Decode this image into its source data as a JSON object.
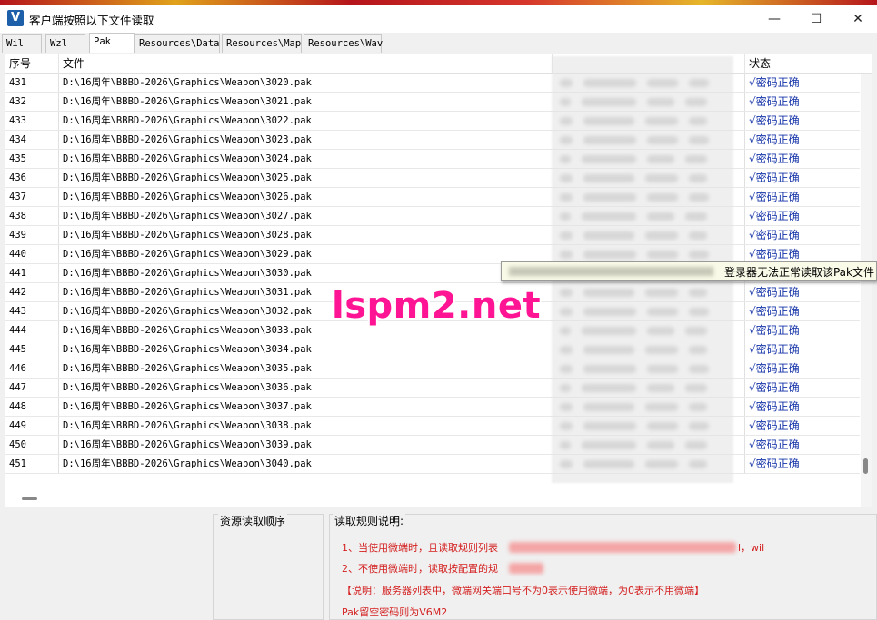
{
  "window": {
    "title": "客户端按照以下文件读取",
    "logo_letter": "V",
    "minimize": "—",
    "maximize": "☐",
    "close": "✕"
  },
  "tabs": [
    {
      "label": "Wil",
      "active": false
    },
    {
      "label": "Wzl",
      "active": false
    },
    {
      "label": "Pak",
      "active": true
    },
    {
      "label": "Resources\\Data",
      "active": false
    },
    {
      "label": "Resources\\Map",
      "active": false
    },
    {
      "label": "Resources\\Wav",
      "active": false
    }
  ],
  "table": {
    "headers": {
      "index": "序号",
      "file": "文件",
      "status": "状态"
    },
    "rows": [
      {
        "index": "431",
        "file": "D:\\16周年\\BBBD-2026\\Graphics\\Weapon\\3020.pak",
        "status": "√密码正确"
      },
      {
        "index": "432",
        "file": "D:\\16周年\\BBBD-2026\\Graphics\\Weapon\\3021.pak",
        "status": "√密码正确"
      },
      {
        "index": "433",
        "file": "D:\\16周年\\BBBD-2026\\Graphics\\Weapon\\3022.pak",
        "status": "√密码正确"
      },
      {
        "index": "434",
        "file": "D:\\16周年\\BBBD-2026\\Graphics\\Weapon\\3023.pak",
        "status": "√密码正确"
      },
      {
        "index": "435",
        "file": "D:\\16周年\\BBBD-2026\\Graphics\\Weapon\\3024.pak",
        "status": "√密码正确"
      },
      {
        "index": "436",
        "file": "D:\\16周年\\BBBD-2026\\Graphics\\Weapon\\3025.pak",
        "status": "√密码正确"
      },
      {
        "index": "437",
        "file": "D:\\16周年\\BBBD-2026\\Graphics\\Weapon\\3026.pak",
        "status": "√密码正确"
      },
      {
        "index": "438",
        "file": "D:\\16周年\\BBBD-2026\\Graphics\\Weapon\\3027.pak",
        "status": "√密码正确"
      },
      {
        "index": "439",
        "file": "D:\\16周年\\BBBD-2026\\Graphics\\Weapon\\3028.pak",
        "status": "√密码正确"
      },
      {
        "index": "440",
        "file": "D:\\16周年\\BBBD-2026\\Graphics\\Weapon\\3029.pak",
        "status": "√密码正确"
      },
      {
        "index": "441",
        "file": "D:\\16周年\\BBBD-2026\\Graphics\\Weapon\\3030.pak",
        "status": ""
      },
      {
        "index": "442",
        "file": "D:\\16周年\\BBBD-2026\\Graphics\\Weapon\\3031.pak",
        "status": "√密码正确"
      },
      {
        "index": "443",
        "file": "D:\\16周年\\BBBD-2026\\Graphics\\Weapon\\3032.pak",
        "status": "√密码正确"
      },
      {
        "index": "444",
        "file": "D:\\16周年\\BBBD-2026\\Graphics\\Weapon\\3033.pak",
        "status": "√密码正确"
      },
      {
        "index": "445",
        "file": "D:\\16周年\\BBBD-2026\\Graphics\\Weapon\\3034.pak",
        "status": "√密码正确"
      },
      {
        "index": "446",
        "file": "D:\\16周年\\BBBD-2026\\Graphics\\Weapon\\3035.pak",
        "status": "√密码正确"
      },
      {
        "index": "447",
        "file": "D:\\16周年\\BBBD-2026\\Graphics\\Weapon\\3036.pak",
        "status": "√密码正确"
      },
      {
        "index": "448",
        "file": "D:\\16周年\\BBBD-2026\\Graphics\\Weapon\\3037.pak",
        "status": "√密码正确"
      },
      {
        "index": "449",
        "file": "D:\\16周年\\BBBD-2026\\Graphics\\Weapon\\3038.pak",
        "status": "√密码正确"
      },
      {
        "index": "450",
        "file": "D:\\16周年\\BBBD-2026\\Graphics\\Weapon\\3039.pak",
        "status": "√密码正确"
      },
      {
        "index": "451",
        "file": "D:\\16周年\\BBBD-2026\\Graphics\\Weapon\\3040.pak",
        "status": "√密码正确"
      }
    ]
  },
  "tooltip": {
    "text": "登录器无法正常读取该Pak文件"
  },
  "watermark": "lspm2.net",
  "bottom": {
    "order_title": "资源读取顺序",
    "rules_title": "读取规则说明:",
    "rules": [
      {
        "prefix": "1、当使用微端时，且读取规则列表",
        "suffix": "l，wil"
      },
      {
        "prefix": "2、不使用微端时，读取按配置的规",
        "suffix": ""
      },
      {
        "prefix": "【说明：服务器列表中，微端网关端口号不为0表示使用微端，为0表示不用微端】",
        "suffix": ""
      },
      {
        "prefix": "Pak留空密码则为V6M2",
        "suffix": ""
      }
    ]
  },
  "colors": {
    "status_text": "#1433a8",
    "rule_text": "#d42020",
    "watermark": "#ff1493"
  }
}
